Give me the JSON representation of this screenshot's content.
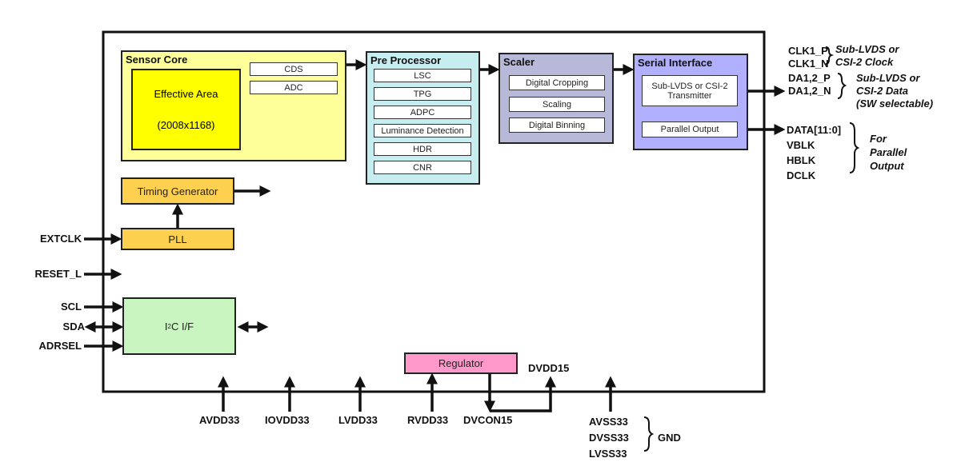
{
  "sensor_core": {
    "title": "Sensor Core",
    "effective_area": "Effective Area",
    "resolution": "(2008x1168)",
    "cds": "CDS",
    "adc": "ADC",
    "color": "#ffff99",
    "area_color": "#ffff00"
  },
  "pre_processor": {
    "title": "Pre Processor",
    "items": [
      "LSC",
      "TPG",
      "ADPC",
      "Luminance Detection",
      "HDR",
      "CNR"
    ],
    "color": "#c6eef0"
  },
  "scaler": {
    "title": "Scaler",
    "items": [
      "Digital Cropping",
      "Scaling",
      "Digital Binning"
    ],
    "color": "#b8b8d8"
  },
  "serial_interface": {
    "title": "Serial Interface",
    "transmitter": "Sub-LVDS or CSI-2 Transmitter",
    "parallel": "Parallel Output",
    "color": "#b0b0ff"
  },
  "timing_generator": {
    "label": "Timing Generator",
    "color": "#fdd04f"
  },
  "pll": {
    "label": "PLL",
    "color": "#fdd04f"
  },
  "i2c": {
    "label_main": "I",
    "label_sup": "2",
    "label_rest": "C I/F",
    "color": "#c8f5c0"
  },
  "regulator": {
    "label": "Regulator",
    "color": "#ff99cc"
  },
  "left_pins": [
    "EXTCLK",
    "RESET_L",
    "SCL",
    "SDA",
    "ADRSEL"
  ],
  "right_pins": {
    "clk": [
      "CLK1_P",
      "CLK1_N"
    ],
    "clk_desc": [
      "Sub-LVDS or",
      "CSI-2 Clock"
    ],
    "data": [
      "DA1,2_P",
      "DA1,2_N"
    ],
    "data_desc": [
      "Sub-LVDS or",
      "CSI-2 Data",
      "(SW selectable)"
    ],
    "parallel": [
      "DATA[11:0]",
      "VBLK",
      "HBLK",
      "DCLK"
    ],
    "parallel_desc": [
      "For",
      "Parallel",
      "Output"
    ]
  },
  "bottom_pins": [
    "AVDD33",
    "IOVDD33",
    "LVDD33",
    "RVDD33",
    "DVCON15"
  ],
  "dvdd15": "DVDD15",
  "gnd_pins": [
    "AVSS33",
    "DVSS33",
    "LVSS33"
  ],
  "gnd": "GND"
}
